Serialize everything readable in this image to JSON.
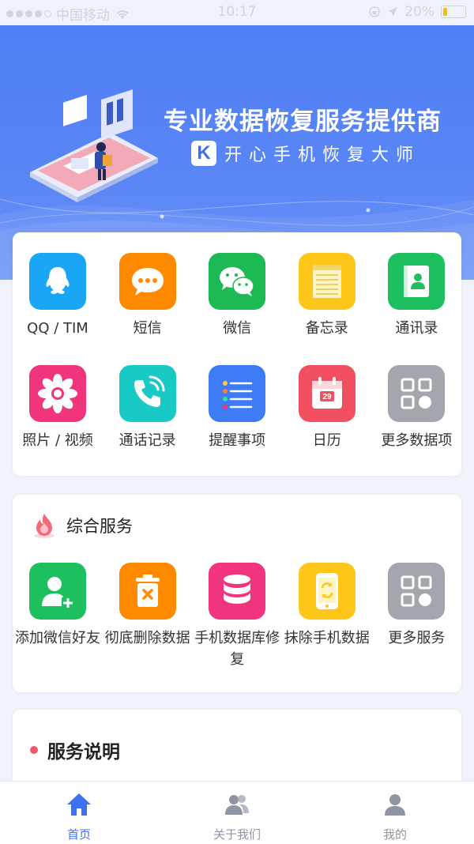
{
  "status_bar": {
    "carrier": "中国移动",
    "time": "10:17",
    "battery": "20%",
    "battery_level": 0.2
  },
  "banner": {
    "title": "专业数据恢复服务提供商",
    "logo_letter": "K",
    "subtitle": "开心手机恢复大师"
  },
  "data_items": [
    {
      "label": "QQ / TIM",
      "icon": "qq-icon",
      "color": "#1ba5f5"
    },
    {
      "label": "短信",
      "icon": "sms-icon",
      "color": "#ff8a00"
    },
    {
      "label": "微信",
      "icon": "wechat-icon",
      "color": "#1db954"
    },
    {
      "label": "备忘录",
      "icon": "memo-icon",
      "color": "#ffc61a"
    },
    {
      "label": "通讯录",
      "icon": "contacts-icon",
      "color": "#1dbf5f"
    },
    {
      "label": "照片 / 视频",
      "icon": "photo-flower-icon",
      "color": "#f0357c"
    },
    {
      "label": "通话记录",
      "icon": "call-log-icon",
      "color": "#19c9c4"
    },
    {
      "label": "提醒事项",
      "icon": "reminder-list-icon",
      "color": "#3d7cf5"
    },
    {
      "label": "日历",
      "icon": "calendar-icon",
      "color": "#f25060",
      "day": "29"
    },
    {
      "label": "更多数据项",
      "icon": "more-grid-icon",
      "color": "#a3a6ad"
    }
  ],
  "services": {
    "title": "综合服务",
    "items": [
      {
        "label": "添加微信好友",
        "icon": "add-friend-icon",
        "color": "#1dbf5f"
      },
      {
        "label": "彻底删除数据",
        "icon": "trash-icon",
        "color": "#ff8a00"
      },
      {
        "label": "手机数据库修复",
        "icon": "database-icon",
        "color": "#f0357c"
      },
      {
        "label": "抹除手机数据",
        "icon": "erase-phone-icon",
        "color": "#ffc61a"
      },
      {
        "label": "更多服务",
        "icon": "more-grid-icon",
        "color": "#a3a6ad"
      }
    ]
  },
  "service_desc": {
    "title": "服务说明"
  },
  "tabs": [
    {
      "label": "首页",
      "icon": "home-icon",
      "active": true
    },
    {
      "label": "关于我们",
      "icon": "people-icon",
      "active": false
    },
    {
      "label": "我的",
      "icon": "user-icon",
      "active": false
    }
  ],
  "colors": {
    "accent": "#3f72f0",
    "banner": "#4f7ff5"
  }
}
